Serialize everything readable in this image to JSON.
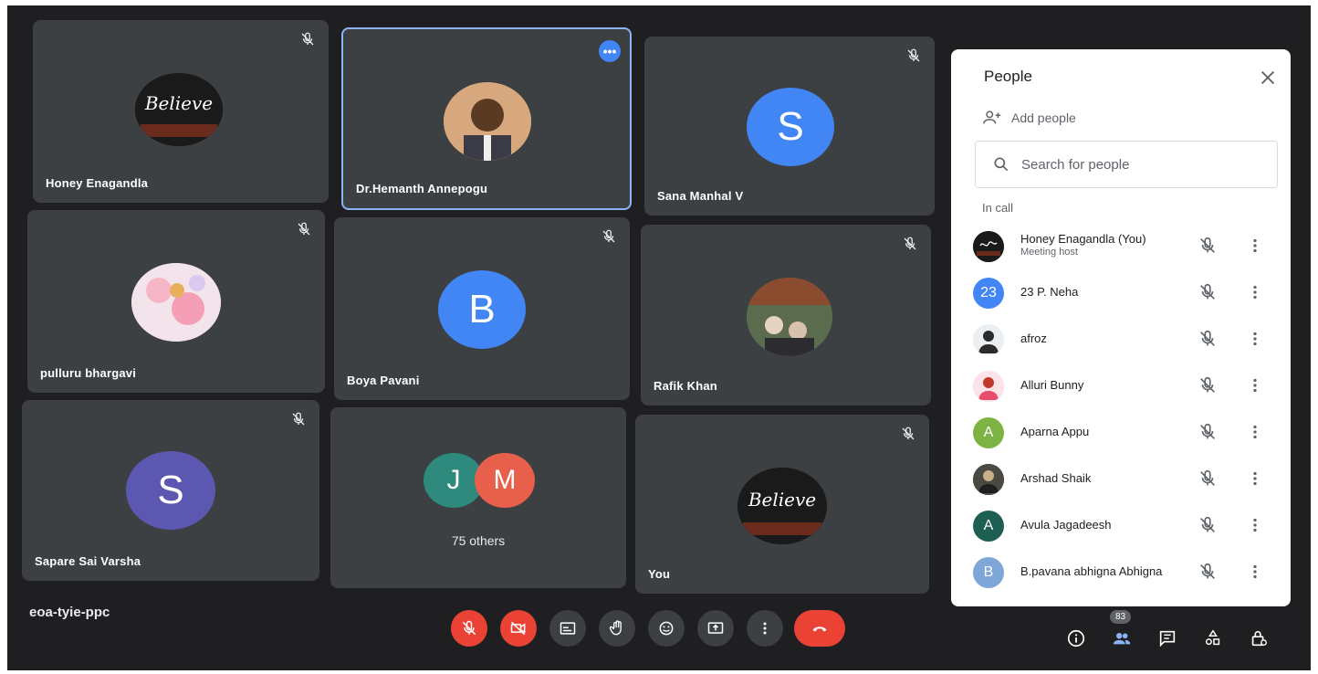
{
  "meeting": {
    "code": "eoa-tyie-ppc"
  },
  "tiles": [
    {
      "name": "Honey Enagandla"
    },
    {
      "name": "Dr.Hemanth Annepogu"
    },
    {
      "name": "Sana Manhal V",
      "initial": "S"
    },
    {
      "name": "pulluru bhargavi"
    },
    {
      "name": "Boya Pavani",
      "initial": "B"
    },
    {
      "name": "Rafik Khan"
    },
    {
      "name": "Sapare Sai Varsha",
      "initial": "S"
    },
    {
      "others_label": "75 others",
      "initials": [
        "J",
        "M"
      ]
    },
    {
      "name": "You"
    }
  ],
  "believe_text": "Believe",
  "panel": {
    "title": "People",
    "add_label": "Add people",
    "search_placeholder": "Search for people",
    "section": "In call",
    "people": [
      {
        "name": "Honey Enagandla (You)",
        "role": "Meeting host"
      },
      {
        "name": "23 P. Neha",
        "initial": "23"
      },
      {
        "name": "afroz"
      },
      {
        "name": "Alluri Bunny"
      },
      {
        "name": "Aparna Appu",
        "initial": "A"
      },
      {
        "name": "Arshad Shaik"
      },
      {
        "name": "Avula Jagadeesh",
        "initial": "A"
      },
      {
        "name": "B.pavana abhigna Abhigna",
        "initial": "B"
      }
    ]
  },
  "participants_count": "83",
  "colors": {
    "tile_bg": "#3c4043",
    "accent_blue": "#4285f4",
    "red": "#ea4335",
    "purple": "#5c58b2",
    "teal": "#2d8a7c",
    "salmon": "#e8604c",
    "green": "#7cb342",
    "dark_teal": "#1e5e53",
    "light_blue": "#7ea7d8"
  }
}
